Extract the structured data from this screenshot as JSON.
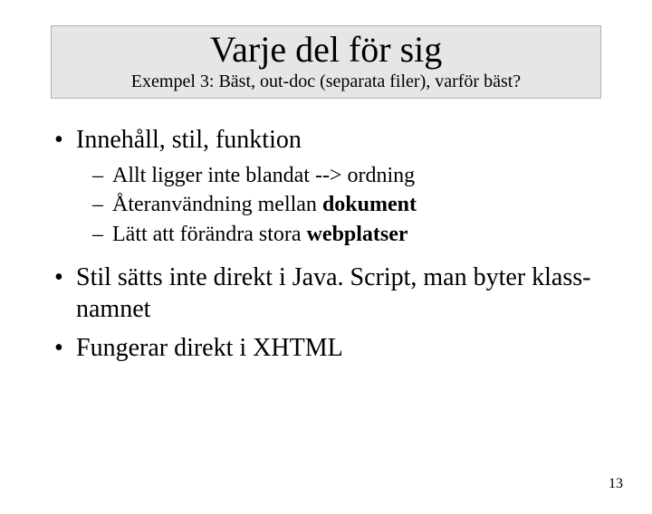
{
  "title": {
    "main": "Varje del för sig",
    "sub": "Exempel 3: Bäst, out-doc (separata filer), varför bäst?"
  },
  "bullets": {
    "b1": {
      "text": "Innehåll, stil, funktion",
      "sub1": "Allt ligger inte blandat --> ordning",
      "sub2_pre": "Återanvändning mellan ",
      "sub2_bold": "dokument",
      "sub3_pre": "Lätt att förändra stora ",
      "sub3_bold": "webplatser"
    },
    "b2": "Stil sätts inte direkt i Java. Script, man byter klass-namnet",
    "b3": "Fungerar direkt i XHTML"
  },
  "page_number": "13"
}
